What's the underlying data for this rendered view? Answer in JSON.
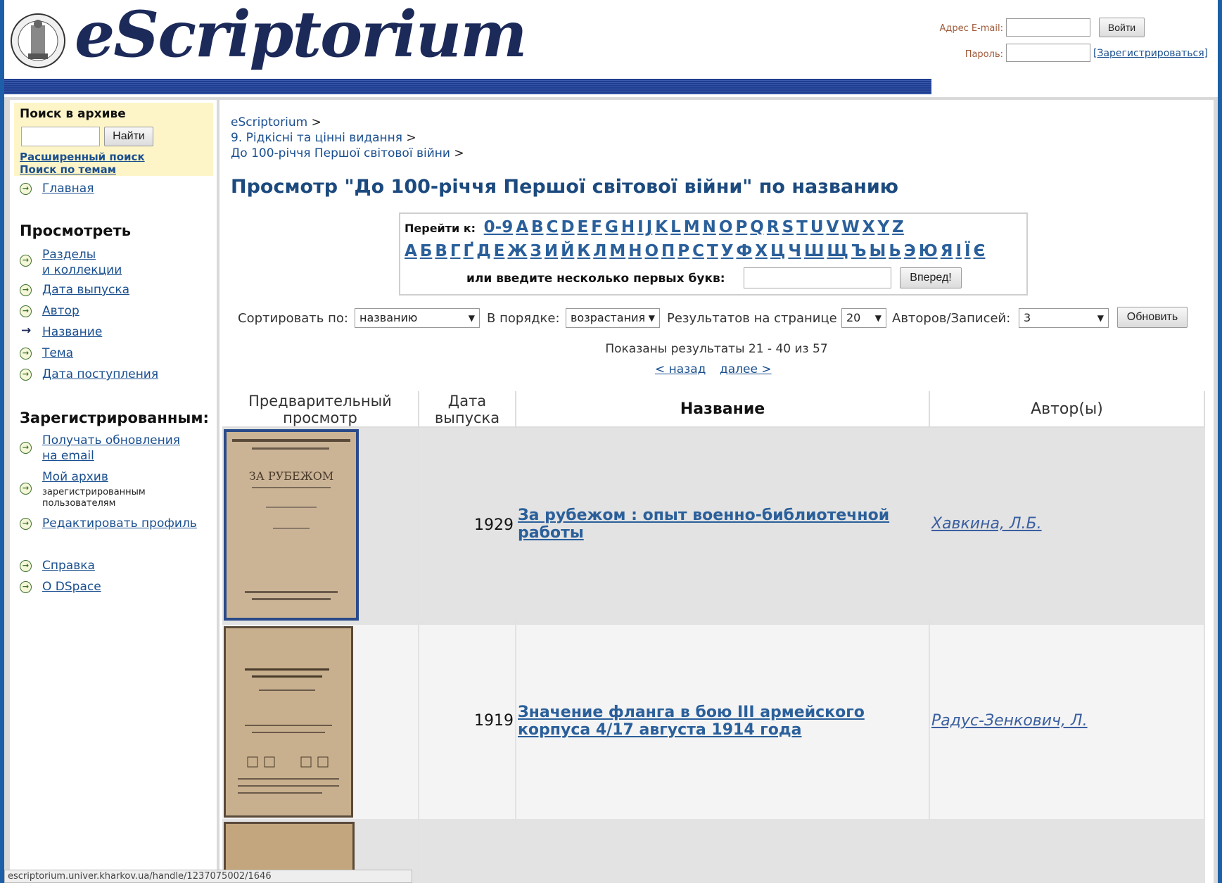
{
  "site": {
    "logo_text": "eScriptorium"
  },
  "login": {
    "email_label": "Адрес E-mail:",
    "password_label": "Пароль:",
    "login_button": "Войти",
    "register_link": "[Зарегистрироваться]"
  },
  "sidebar": {
    "search_heading": "Поиск в архиве",
    "search_button": "Найти",
    "advanced_search": "Расширенный поиск",
    "topic_search": "Поиск по темам",
    "home": "Главная",
    "browse_heading": "Просмотреть",
    "browse": {
      "sections_line1": "Разделы",
      "sections_line2": "и коллекции",
      "issue_date": "Дата выпуска",
      "author": "Автор",
      "title": "Название",
      "subject": "Тема",
      "date_accessioned": "Дата поступления"
    },
    "registered_heading": "Зарегистрированным:",
    "registered": {
      "updates_line1": "Получать обновления",
      "updates_line2": "на email",
      "my_archive": "Мой архив",
      "my_archive_note_line1": "зарегистрированным",
      "my_archive_note_line2": "пользователям",
      "edit_profile": "Редактировать профиль"
    },
    "help": "Справка",
    "about": "О DSpace"
  },
  "breadcrumbs": [
    "eScriptorium",
    "9. Рідкісні та цінні видання",
    "До 100-річчя Першої світової війни"
  ],
  "crumb_sep": ">",
  "page_title": "Просмотр \"До 100-річчя Першої світової війни\" по названию",
  "jump": {
    "label": "Перейти к:",
    "latin": [
      "0-9",
      "A",
      "B",
      "C",
      "D",
      "E",
      "F",
      "G",
      "H",
      "I",
      "J",
      "K",
      "L",
      "M",
      "N",
      "O",
      "P",
      "Q",
      "R",
      "S",
      "T",
      "U",
      "V",
      "W",
      "X",
      "Y",
      "Z"
    ],
    "cyrillic": [
      "А",
      "Б",
      "В",
      "Г",
      "Ґ",
      "Д",
      "Е",
      "Ж",
      "З",
      "И",
      "Й",
      "К",
      "Л",
      "М",
      "Н",
      "О",
      "П",
      "Р",
      "С",
      "Т",
      "У",
      "Ф",
      "Х",
      "Ц",
      "Ч",
      "Ш",
      "Щ",
      "Ъ",
      "Ы",
      "Ь",
      "Э",
      "Ю",
      "Я",
      "І",
      "Ї",
      "Є"
    ],
    "input_label": "или введите несколько первых букв:",
    "go_button": "Вперед!"
  },
  "sort": {
    "sort_by_label": "Сортировать по:",
    "sort_by_value": "названию",
    "order_label": "В порядке:",
    "order_value": "возрастания",
    "rpp_label": "Результатов на странице",
    "rpp_value": "20",
    "authors_label": "Авторов/Записей:",
    "authors_value": "3",
    "update_button": "Обновить"
  },
  "results": {
    "summary": "Показаны результаты 21 - 40 из 57",
    "prev": "< назад",
    "next": "далее >"
  },
  "table": {
    "headers": {
      "preview_line1": "Предварительный",
      "preview_line2": "просмотр",
      "date_line1": "Дата",
      "date_line2": "выпуска",
      "title": "Название",
      "authors": "Автор(ы)"
    },
    "rows": [
      {
        "year": "1929",
        "title_line1": "За рубежом : опыт военно-библиотечной",
        "title_line2": "работы",
        "author": "Хавкина, Л.Б.",
        "thumb_text": "ЗА РУБЕЖОМ"
      },
      {
        "year": "1919",
        "title_line1": "Значение фланга в бою III армейского",
        "title_line2": "корпуса 4/17 августа 1914 года",
        "author": "Радус-Зенкович, Л."
      }
    ]
  },
  "statusbar": "escriptorium.univer.kharkov.ua/handle/123707500​2/1646",
  "colors": {
    "link": "#1a4f8f",
    "title_blue": "#1c4a7e",
    "search_bg": "#fdf5c8",
    "header_bar": "#1f3d8f"
  }
}
